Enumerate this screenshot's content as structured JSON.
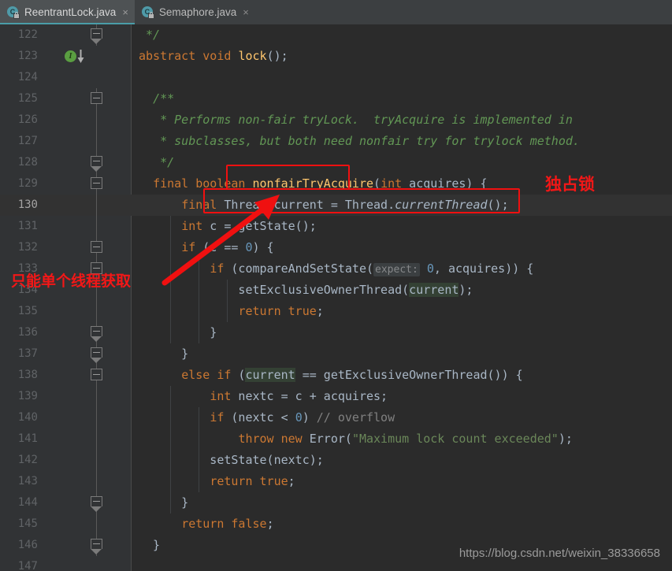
{
  "window": {
    "background": "#2b2b2b",
    "gutter_background": "#313335",
    "accent": "#4a9da8",
    "annotation_color": "#f31717"
  },
  "tabs": [
    {
      "label": "ReentrantLock.java",
      "icon": "java-class-locked-icon",
      "close": "×",
      "letter": "C",
      "active": true
    },
    {
      "label": "Semaphore.java",
      "icon": "java-class-locked-icon",
      "close": "×",
      "letter": "C",
      "active": false
    }
  ],
  "gutter": {
    "impl_icon_letter": "I",
    "impl_icon_line": 123
  },
  "lines": [
    {
      "n": "122",
      "fold": "close",
      "html": "<span class=\"cmt\"> */</span>"
    },
    {
      "n": "123",
      "fold": "none",
      "impl": true,
      "html": "<span class=\"kw\">abstract</span> <span class=\"kw\">void</span> <span class=\"mth\">lock</span>();"
    },
    {
      "n": "124",
      "fold": "none",
      "html": ""
    },
    {
      "n": "125",
      "fold": "openTop",
      "html": "  <span class=\"cmt\">/**</span>"
    },
    {
      "n": "126",
      "fold": "line",
      "html": "   <span class=\"cmt\">* Performs non-fair tryLock.  tryAcquire is implemented in</span>"
    },
    {
      "n": "127",
      "fold": "line",
      "html": "   <span class=\"cmt\">* subclasses, but both need nonfair try for trylock method.</span>"
    },
    {
      "n": "128",
      "fold": "close",
      "html": "   <span class=\"cmt\">*/</span>"
    },
    {
      "n": "129",
      "fold": "openTop",
      "html": "  <span class=\"kw\">final</span> <span class=\"kw\">boolean</span> <span class=\"mth\">nonfairTryAcquire</span>(<span class=\"kw\">int</span> acquires) {"
    },
    {
      "n": "130",
      "fold": "line",
      "caret": true,
      "html": "      <span class=\"kw\">final</span> Thread current = Thread.<span class=\"ital\">currentThread</span>();"
    },
    {
      "n": "131",
      "fold": "line",
      "html": "      <span class=\"kw\">int</span> c = getState();"
    },
    {
      "n": "132",
      "fold": "openTop",
      "html": "      <span class=\"kw\">if</span> (c == <span class=\"num\">0</span>) {"
    },
    {
      "n": "133",
      "fold": "openTop",
      "html": "          <span class=\"kw\">if</span> (compareAndSetState(<span class=\"hint\">expect:</span> <span class=\"num\">0</span>, acquires)) {"
    },
    {
      "n": "134",
      "fold": "line",
      "html": "              setExclusiveOwnerThread(<span class=\"hl\">current</span>);"
    },
    {
      "n": "135",
      "fold": "line",
      "html": "              <span class=\"kw\">return</span> <span class=\"kw\">true</span>;"
    },
    {
      "n": "136",
      "fold": "close",
      "html": "          }"
    },
    {
      "n": "137",
      "fold": "close",
      "html": "      }"
    },
    {
      "n": "138",
      "fold": "openTop",
      "html": "      <span class=\"kw\">else if</span> (<span class=\"hl\">current</span> == getExclusiveOwnerThread()) {"
    },
    {
      "n": "139",
      "fold": "line",
      "html": "          <span class=\"kw\">int</span> nextc = c + acquires;"
    },
    {
      "n": "140",
      "fold": "line",
      "html": "          <span class=\"kw\">if</span> (nextc &lt; <span class=\"num\">0</span>) <span class=\"lcmt\">// overflow</span>"
    },
    {
      "n": "141",
      "fold": "line",
      "html": "              <span class=\"kw\">throw new</span> Error(<span class=\"str\">\"Maximum lock count exceeded\"</span>);"
    },
    {
      "n": "142",
      "fold": "line",
      "html": "          setState(nextc);"
    },
    {
      "n": "143",
      "fold": "line",
      "html": "          <span class=\"kw\">return</span> <span class=\"kw\">true</span>;"
    },
    {
      "n": "144",
      "fold": "close",
      "html": "      }"
    },
    {
      "n": "145",
      "fold": "line",
      "html": "      <span class=\"kw\">return</span> <span class=\"kw\">false</span>;"
    },
    {
      "n": "146",
      "fold": "close",
      "html": "  }"
    },
    {
      "n": "147",
      "fold": "none",
      "html": ""
    }
  ],
  "annotations": {
    "exclusive_lock_label": "独占锁",
    "single_thread_label": "只能单个线程获取",
    "box_method_name": "nonfairTryAcquire",
    "box_statement": "final Thread current = Thread.currentThread();"
  },
  "watermark": {
    "url": "https://blog.csdn.net/weixin_38336658"
  }
}
